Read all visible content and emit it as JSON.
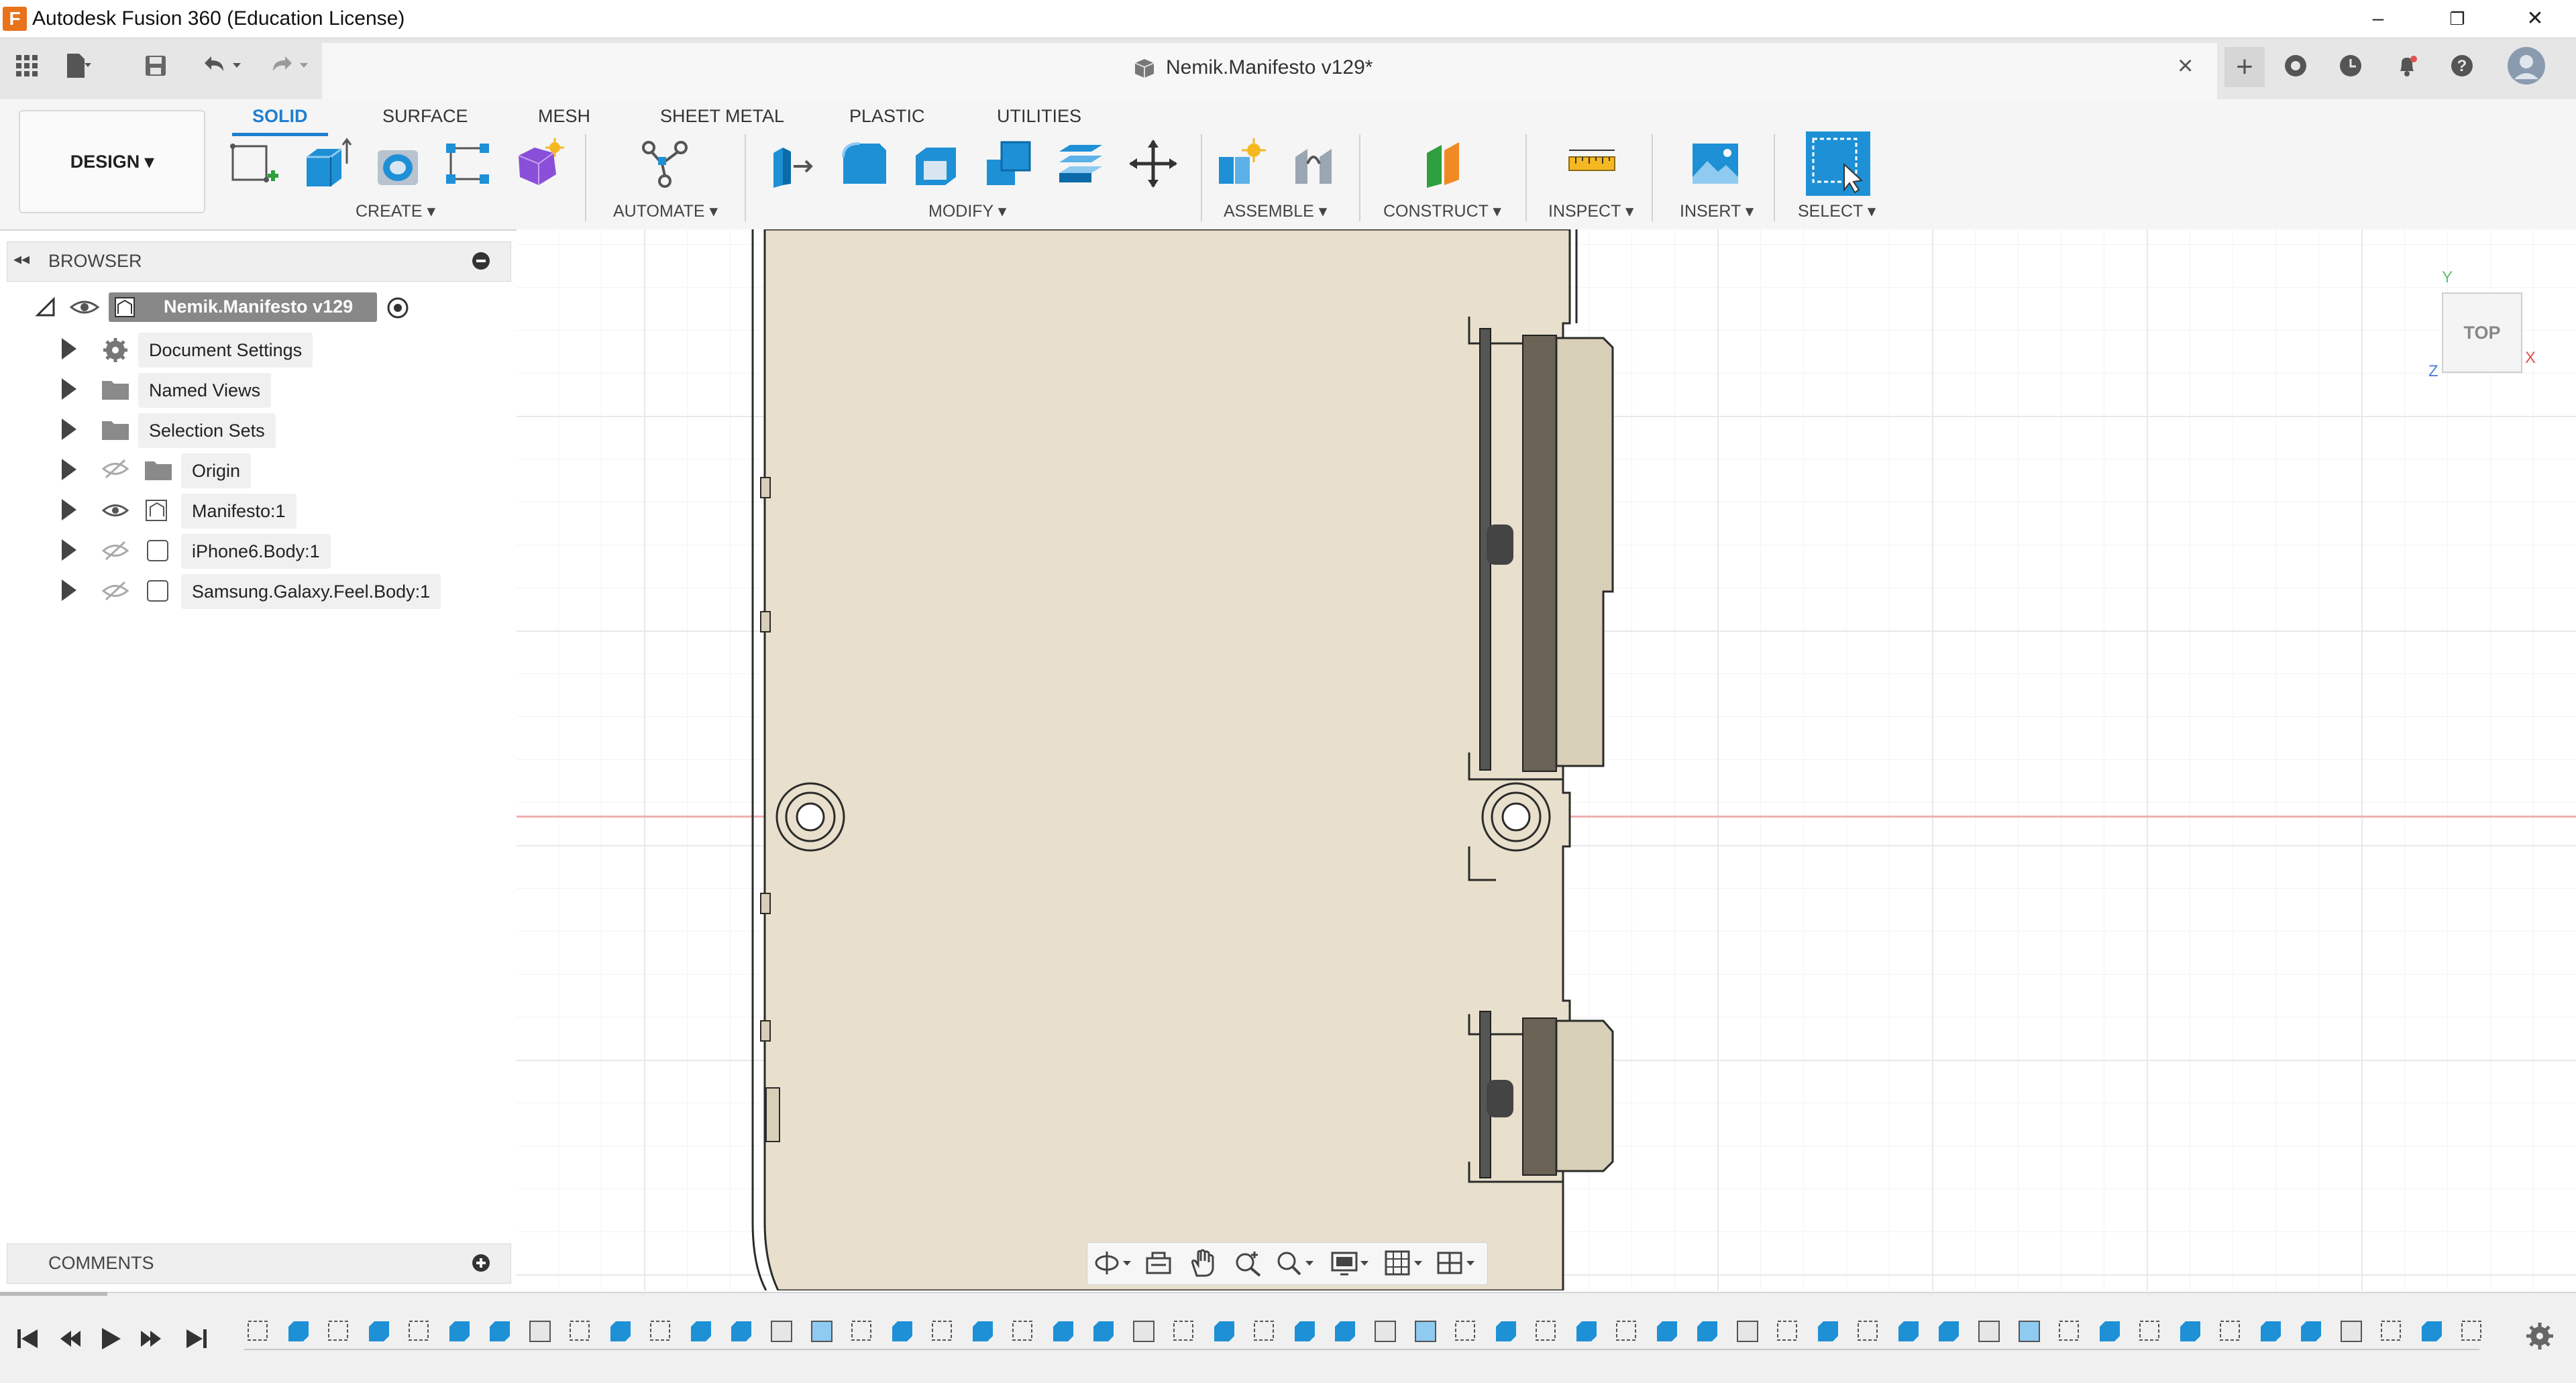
{
  "app": {
    "title": "Autodesk Fusion 360 (Education License)",
    "logo_letter": "F"
  },
  "window_controls": {
    "minimize": "–",
    "restore": "❐",
    "close": "✕"
  },
  "document": {
    "title": "Nemik.Manifesto v129*",
    "close_glyph": "×",
    "new_tab_glyph": "+"
  },
  "ribbon": {
    "workspace": "DESIGN ▾",
    "tabs": [
      "SOLID",
      "SURFACE",
      "MESH",
      "SHEET METAL",
      "PLASTIC",
      "UTILITIES"
    ],
    "groups": {
      "create": "CREATE ▾",
      "automate": "AUTOMATE ▾",
      "modify": "MODIFY ▾",
      "assemble": "ASSEMBLE ▾",
      "construct": "CONSTRUCT ▾",
      "inspect": "INSPECT ▾",
      "insert": "INSERT ▾",
      "select": "SELECT ▾"
    }
  },
  "browser": {
    "title": "BROWSER",
    "root": "Nemik.Manifesto v129",
    "items": [
      {
        "label": "Document Settings"
      },
      {
        "label": "Named Views"
      },
      {
        "label": "Selection Sets"
      },
      {
        "label": "Origin"
      },
      {
        "label": "Manifesto:1"
      },
      {
        "label": "iPhone6.Body:1"
      },
      {
        "label": "Samsung.Galaxy.Feel.Body:1"
      }
    ]
  },
  "comments": {
    "title": "COMMENTS"
  },
  "viewcube": {
    "face": "TOP",
    "axis_x": "X",
    "axis_y": "Y",
    "axis_z": "Z"
  },
  "colors": {
    "accent": "#1f7fd0",
    "part_fill": "#e8e0cc",
    "part_edge": "#2b2b2b",
    "select_blue": "#1e90d6",
    "logo_orange": "#e8731a",
    "axis_red": "#e05050"
  }
}
